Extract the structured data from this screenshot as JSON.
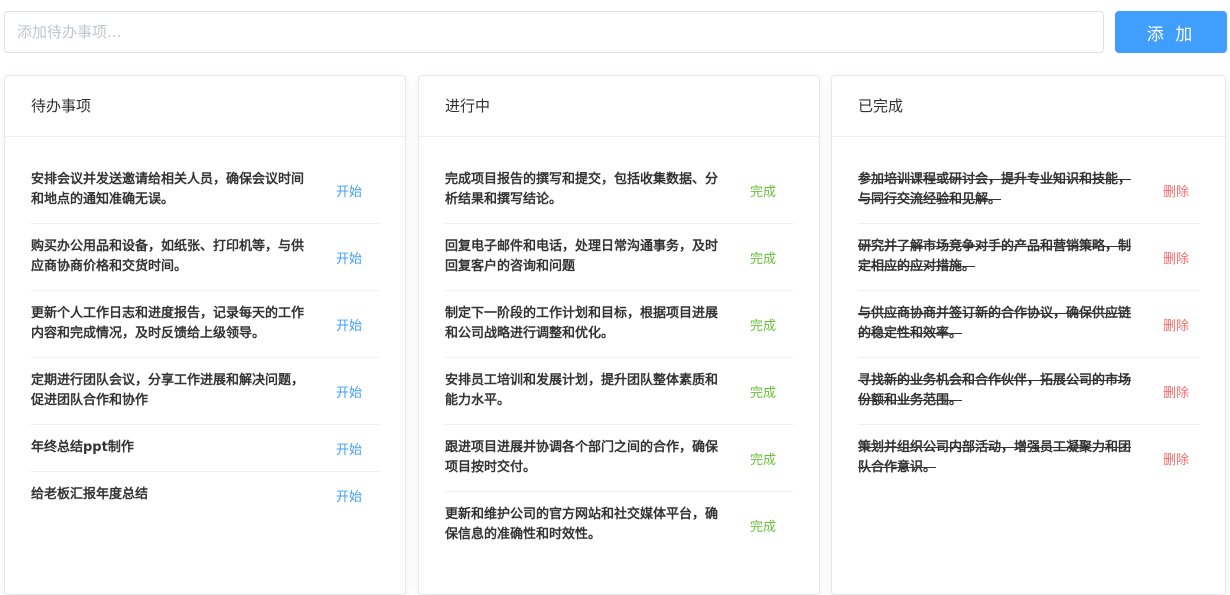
{
  "input": {
    "placeholder": "添加待办事项...",
    "value": ""
  },
  "add_button": {
    "label": "添 加"
  },
  "columns": {
    "todo": {
      "title": "待办事项",
      "action": "开始",
      "items": [
        "安排会议并发送邀请给相关人员，确保会议时间和地点的通知准确无误。",
        "购买办公用品和设备，如纸张、打印机等，与供应商协商价格和交货时间。",
        "更新个人工作日志和进度报告，记录每天的工作内容和完成情况，及时反馈给上级领导。",
        "定期进行团队会议，分享工作进展和解决问题，促进团队合作和协作",
        "年终总结ppt制作",
        "给老板汇报年度总结"
      ]
    },
    "doing": {
      "title": "进行中",
      "action": "完成",
      "items": [
        "完成项目报告的撰写和提交，包括收集数据、分析结果和撰写结论。",
        "回复电子邮件和电话，处理日常沟通事务，及时回复客户的咨询和问题",
        "制定下一阶段的工作计划和目标，根据项目进展和公司战略进行调整和优化。",
        "安排员工培训和发展计划，提升团队整体素质和能力水平。",
        "跟进项目进展并协调各个部门之间的合作，确保项目按时交付。",
        "更新和维护公司的官方网站和社交媒体平台，确保信息的准确性和时效性。"
      ]
    },
    "done": {
      "title": "已完成",
      "action": "删除",
      "items": [
        "参加培训课程或研讨会，提升专业知识和技能，与同行交流经验和见解。",
        "研究并了解市场竞争对手的产品和营销策略，制定相应的应对措施。",
        "与供应商协商并签订新的合作协议，确保供应链的稳定性和效率。",
        "寻找新的业务机会和合作伙伴，拓展公司的市场份额和业务范围。",
        "策划并组织公司内部活动，增强员工凝聚力和团队合作意识。"
      ]
    }
  },
  "colors": {
    "primary": "#409eff",
    "success": "#67c23a",
    "danger": "#f56c6c"
  }
}
